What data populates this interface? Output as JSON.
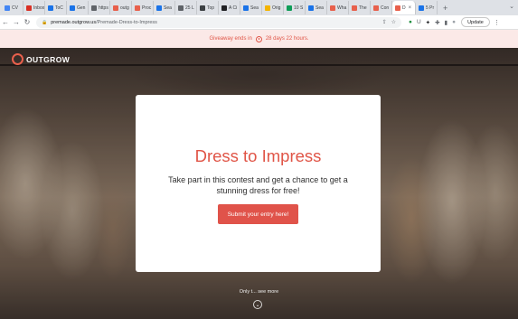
{
  "browser": {
    "tabs": [
      {
        "label": "CV",
        "color": "#4285f4"
      },
      {
        "label": "Inbox",
        "color": "#d93025"
      },
      {
        "label": "ToC",
        "color": "#1a73e8"
      },
      {
        "label": "Gen",
        "color": "#1a73e8"
      },
      {
        "label": "https",
        "color": "#5f6368"
      },
      {
        "label": "outg",
        "color": "#e8604c"
      },
      {
        "label": "Proc",
        "color": "#e8604c"
      },
      {
        "label": "Sea",
        "color": "#1a73e8"
      },
      {
        "label": "25 L",
        "color": "#5f6368"
      },
      {
        "label": "Top",
        "color": "#3c4043"
      },
      {
        "label": "A Ci",
        "color": "#202124"
      },
      {
        "label": "Sea",
        "color": "#1a73e8"
      },
      {
        "label": "Orig",
        "color": "#f4b400"
      },
      {
        "label": "10 S",
        "color": "#0f9d58"
      },
      {
        "label": "Sea",
        "color": "#1a73e8"
      },
      {
        "label": "Wha",
        "color": "#e8604c"
      },
      {
        "label": "The",
        "color": "#e8604c"
      },
      {
        "label": "Con",
        "color": "#e8604c"
      },
      {
        "label": "D",
        "color": "#e8604c",
        "active": true
      },
      {
        "label": "5 Pr",
        "color": "#1a73e8"
      }
    ],
    "url_domain": "premade.outgrow.us",
    "url_path": "/Premade-Dress-to-Impress",
    "update_label": "Update"
  },
  "banner": {
    "text": "Giveaway ends in",
    "countdown": "28 days 22 hours."
  },
  "hero": {
    "logo_text": "OUTGROW",
    "title": "Dress to Impress",
    "description": "Take part in this contest and get a chance to get a stunning dress for free!",
    "cta_label": "Submit your entry here!",
    "scroll_text": "Only t... see more"
  },
  "colors": {
    "accent": "#e05547",
    "banner_bg": "#fbe9e7"
  }
}
